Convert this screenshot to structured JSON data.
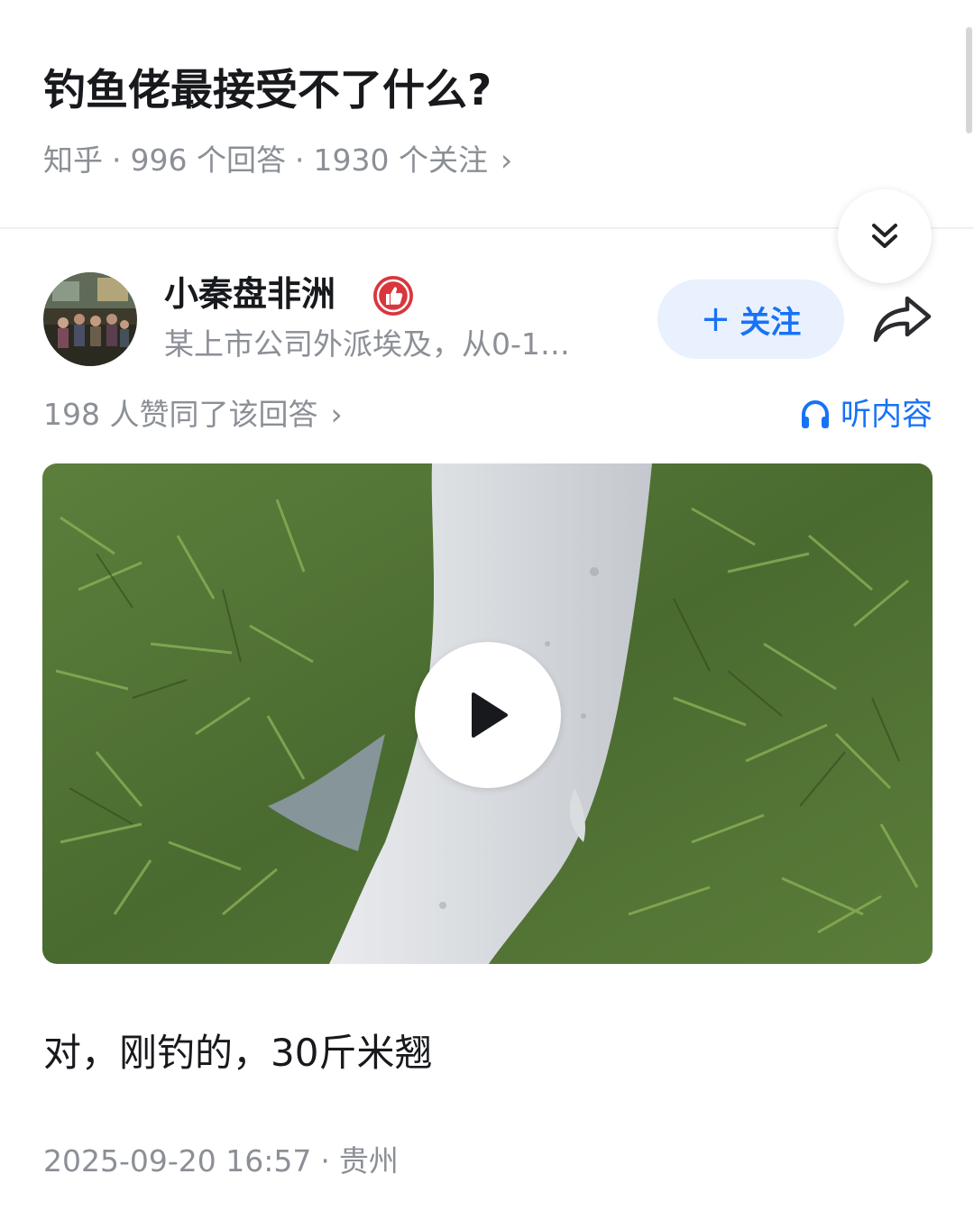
{
  "question": {
    "title": "钓鱼佬最接受不了什么?",
    "source": "知乎",
    "separator": "·",
    "answer_count": "996 个回答",
    "follower_count": "1930 个关注",
    "chevron": "›"
  },
  "controls": {
    "collapse_icon": "double-chevron-down-icon"
  },
  "author": {
    "name": "小秦盘非洲",
    "bio": "某上市公司外派埃及，从0-1…",
    "badge_icon": "thumbs-up-badge-icon",
    "follow_label": "关注",
    "follow_plus": "+",
    "share_icon": "share-icon"
  },
  "answer": {
    "votes": "198 人赞同了该回答",
    "votes_chevron": "›",
    "listen_label": "听内容",
    "text": "对，刚钓的，30斤米翘",
    "date": "2025-09-20 16:57",
    "separator": "·",
    "location": "贵州"
  },
  "video": {
    "play_icon": "play-icon"
  },
  "colors": {
    "accent": "#1772f6",
    "follow_bg": "#e8f1fd",
    "muted_text": "#8b8f96",
    "badge": "#d9363e"
  }
}
